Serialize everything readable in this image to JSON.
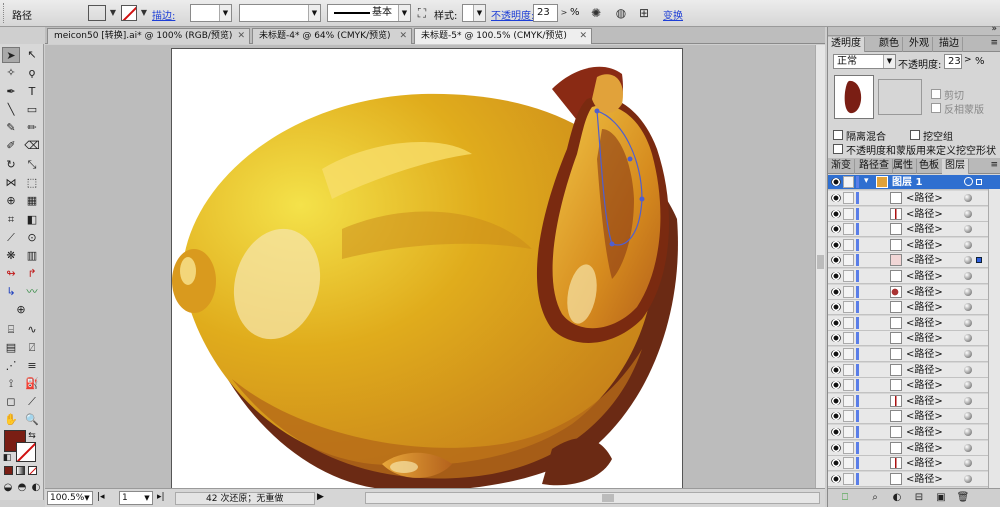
{
  "control_bar": {
    "object_type": "路径",
    "fill_color": "#7a1e14",
    "stroke_label": "描边:",
    "stroke_weight": "",
    "variable_width": "",
    "brush_profile": "基本",
    "style_label": "样式:",
    "opacity_label": "不透明度:",
    "opacity_value": "23",
    "opacity_unit": "%",
    "transform_label": "变换"
  },
  "doc_tabs": [
    {
      "label": "meicon50 [转换].ai* @ 100% (RGB/预览)",
      "active": false
    },
    {
      "label": "未标题-4* @ 64% (CMYK/预览)",
      "active": false
    },
    {
      "label": "未标题-5* @ 100.5% (CMYK/预览)",
      "active": true
    }
  ],
  "status_bar": {
    "zoom": "100.5%",
    "artboard": "1",
    "status_text": "42 次还原；无重做"
  },
  "transparency_panel": {
    "tabs": [
      "透明度",
      "颜色",
      "外观",
      "描边"
    ],
    "blend_mode": "正常",
    "opacity_label": "不透明度:",
    "opacity_value": "23",
    "opacity_unit": "%",
    "clip_label": "剪切",
    "invert_mask_label": "反相蒙版",
    "isolate_blending_label": "隔离混合",
    "knockout_group_label": "挖空组",
    "opacity_mask_label": "不透明度和蒙版用来定义挖空形状"
  },
  "layers_panel": {
    "tabs": [
      "渐变",
      "路径查",
      "属性",
      "色板",
      "图层"
    ],
    "layer_name": "图层 1",
    "items": [
      {
        "name": "<路径>",
        "thumb": "stroke"
      },
      {
        "name": "<路径>",
        "thumb": "red-line"
      },
      {
        "name": "<路径>",
        "thumb": "blank"
      },
      {
        "name": "<路径>",
        "thumb": "blank"
      },
      {
        "name": "<路径>",
        "thumb": "pink",
        "selected": true
      },
      {
        "name": "<路径>",
        "thumb": "blank"
      },
      {
        "name": "<路径>",
        "thumb": "red-shape"
      },
      {
        "name": "<路径>",
        "thumb": "blank"
      },
      {
        "name": "<路径>",
        "thumb": "blank"
      },
      {
        "name": "<路径>",
        "thumb": "blank"
      },
      {
        "name": "<路径>",
        "thumb": "stroke"
      },
      {
        "name": "<路径>",
        "thumb": "blank"
      },
      {
        "name": "<路径>",
        "thumb": "blank"
      },
      {
        "name": "<路径>",
        "thumb": "red-line"
      },
      {
        "name": "<路径>",
        "thumb": "blank"
      },
      {
        "name": "<路径>",
        "thumb": "blank"
      },
      {
        "name": "<路径>",
        "thumb": "blank"
      },
      {
        "name": "<路径>",
        "thumb": "red-line"
      },
      {
        "name": "<路径>",
        "thumb": "blank"
      }
    ]
  },
  "tool_colors": {
    "fill": "#7a1e14",
    "stroke": "#ffffff"
  },
  "canvas": {
    "artboard_bg": "#ffffff",
    "turkey_gold": "#e3b01c",
    "turkey_dark": "#8a3e10",
    "shadow": "#6b2a14"
  }
}
